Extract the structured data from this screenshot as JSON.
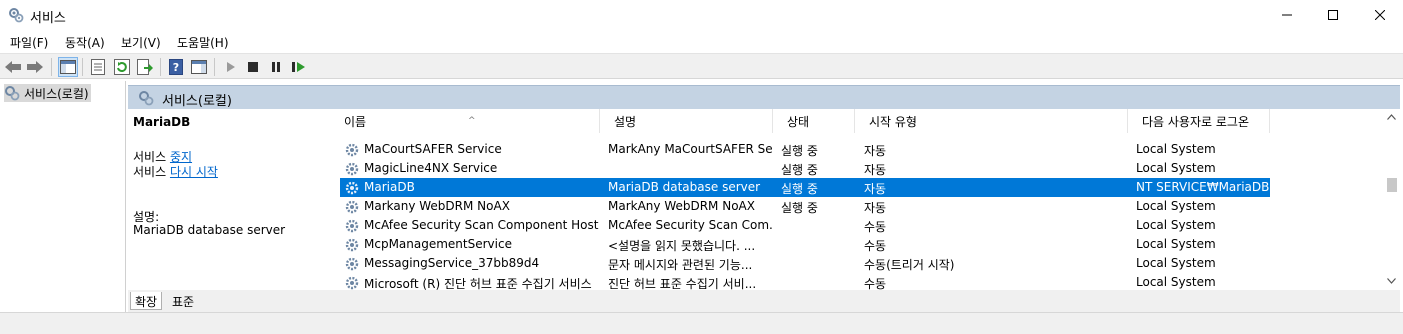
{
  "window": {
    "title": "서비스"
  },
  "menu": [
    "파일(F)",
    "동작(A)",
    "보기(V)",
    "도움말(H)"
  ],
  "tree": {
    "root_label": "서비스(로컬)"
  },
  "pane": {
    "header": "서비스(로컬)"
  },
  "detail": {
    "service_name": "MariaDB",
    "stop_prefix": "서비스",
    "stop_link": "중지",
    "restart_prefix": "서비스",
    "restart_link": "다시 시작",
    "desc_label": "설명:",
    "desc_value": "MariaDB database server"
  },
  "columns": {
    "name": "이름",
    "description": "설명",
    "status": "상태",
    "startup": "시작 유형",
    "logon": "다음 사용자로 로그온"
  },
  "rows": [
    {
      "name": "MaCourtSAFER Service",
      "description": "MarkAny MaCourtSAFER Se...",
      "status": "실행 중",
      "startup": "자동",
      "logon": "Local System"
    },
    {
      "name": "MagicLine4NX Service",
      "description": "",
      "status": "실행 중",
      "startup": "자동",
      "logon": "Local System"
    },
    {
      "name": "MariaDB",
      "description": "MariaDB database server",
      "status": "실행 중",
      "startup": "자동",
      "logon": "NT SERVICE₩MariaDB"
    },
    {
      "name": "Markany WebDRM NoAX",
      "description": "MarkAny WebDRM NoAX",
      "status": "실행 중",
      "startup": "자동",
      "logon": "Local System"
    },
    {
      "name": "McAfee Security Scan Component Host S...",
      "description": "McAfee Security Scan Com...",
      "status": "",
      "startup": "수동",
      "logon": "Local System"
    },
    {
      "name": "McpManagementService",
      "description": "<설명을 읽지 못했습니다. ...",
      "status": "",
      "startup": "수동",
      "logon": "Local System"
    },
    {
      "name": "MessagingService_37bb89d4",
      "description": "문자 메시지와 관련된 기능...",
      "status": "",
      "startup": "수동(트리거 시작)",
      "logon": "Local System"
    },
    {
      "name": "Microsoft (R) 진단 허브 표준 수집기 서비스",
      "description": "진단 허브 표준 수집기 서비...",
      "status": "",
      "startup": "수동",
      "logon": "Local System"
    }
  ],
  "tabs": {
    "extended": "확장",
    "standard": "표준"
  },
  "colors": {
    "selection": "#0078d7",
    "pane_header": "#c4d3e3",
    "link": "#0066cc"
  }
}
